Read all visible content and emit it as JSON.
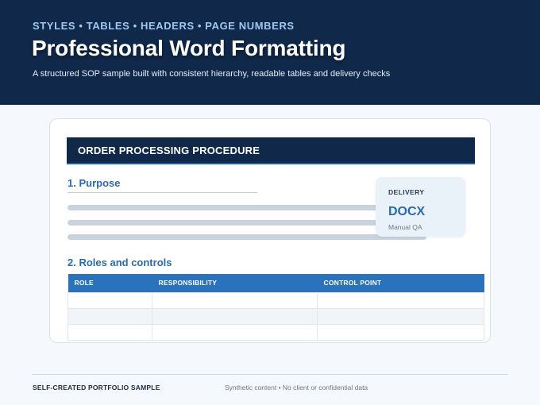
{
  "hero": {
    "kicker": "STYLES • TABLES • HEADERS • PAGE NUMBERS",
    "title": "Professional Word Formatting",
    "subtitle": "A structured SOP sample built with consistent hierarchy, readable tables and delivery checks"
  },
  "document": {
    "banner_title": "ORDER PROCESSING PROCEDURE",
    "section1_title": "1. Purpose",
    "section2_title": "2. Roles and controls",
    "delivery": {
      "label": "DELIVERY",
      "value": "DOCX",
      "note": "Manual QA"
    },
    "table": {
      "headers": [
        "ROLE",
        "RESPONSIBILITY",
        "CONTROL POINT"
      ],
      "rows": [
        [
          "",
          "",
          ""
        ],
        [
          "",
          "",
          ""
        ],
        [
          "",
          "",
          ""
        ]
      ]
    }
  },
  "footer": {
    "left": "SELF-CREATED PORTFOLIO SAMPLE",
    "right": "Synthetic content • No client or confidential data"
  },
  "colors": {
    "navy": "#10294a",
    "accent_blue": "#2a72bc",
    "kicker_blue": "#9fc8ee"
  }
}
